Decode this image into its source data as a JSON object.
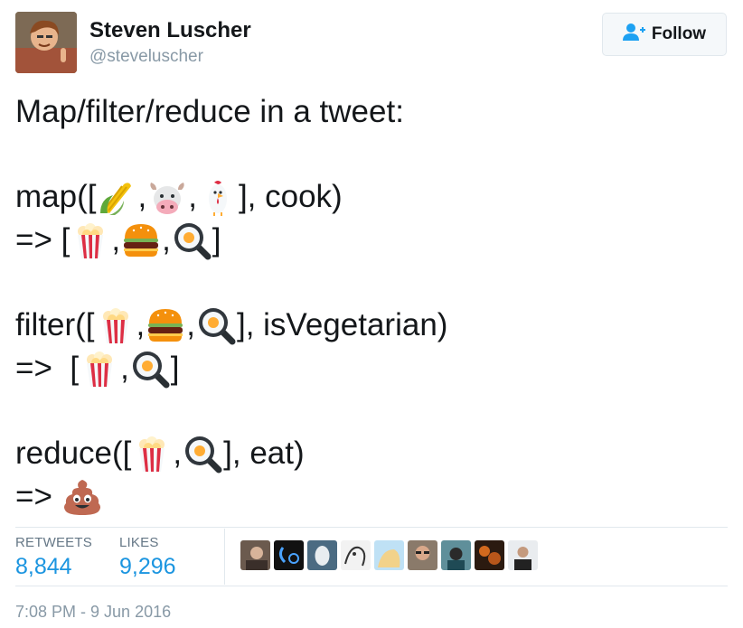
{
  "author": {
    "name": "Steven Luscher",
    "handle": "@steveluscher",
    "avatar_icon": "user-avatar"
  },
  "follow_button": {
    "label": "Follow",
    "icon": "add-user-icon",
    "accent": "#1da1f2"
  },
  "tweet": {
    "intro": "Map/filter/reduce in a tweet:",
    "map_line1": {
      "prefix": "map([",
      "sep1": ",",
      "sep2": ",",
      "suffix": "], cook)",
      "emojis": [
        "corn-emoji",
        "cow-emoji",
        "chicken-emoji"
      ]
    },
    "map_line2": {
      "prefix": "=> [",
      "sep1": ",",
      "sep2": ",",
      "suffix": "]",
      "emojis": [
        "popcorn-emoji",
        "hamburger-emoji",
        "fried-egg-emoji"
      ]
    },
    "filter_line1": {
      "prefix": "filter([",
      "sep1": ",",
      "sep2": ",",
      "suffix": "], isVegetarian)",
      "emojis": [
        "popcorn-emoji",
        "hamburger-emoji",
        "fried-egg-emoji"
      ]
    },
    "filter_line2": {
      "prefix": "=>  [",
      "sep1": ",",
      "suffix": "]",
      "emojis": [
        "popcorn-emoji",
        "fried-egg-emoji"
      ]
    },
    "reduce_line1": {
      "prefix": "reduce([",
      "sep1": ",",
      "suffix": "], eat)",
      "emojis": [
        "popcorn-emoji",
        "fried-egg-emoji"
      ]
    },
    "reduce_line2": {
      "prefix": "=>",
      "emojis": [
        "poop-emoji"
      ]
    }
  },
  "stats": {
    "retweets_label": "RETWEETS",
    "retweets_count": "8,844",
    "likes_label": "LIKES",
    "likes_count": "9,296",
    "count_color": "#1b95e0"
  },
  "likers": [
    "liker-avatar",
    "liker-avatar",
    "liker-avatar",
    "liker-avatar",
    "liker-avatar",
    "liker-avatar",
    "liker-avatar",
    "liker-avatar",
    "liker-avatar"
  ],
  "timestamp": "7:08 PM - 9 Jun 2016"
}
